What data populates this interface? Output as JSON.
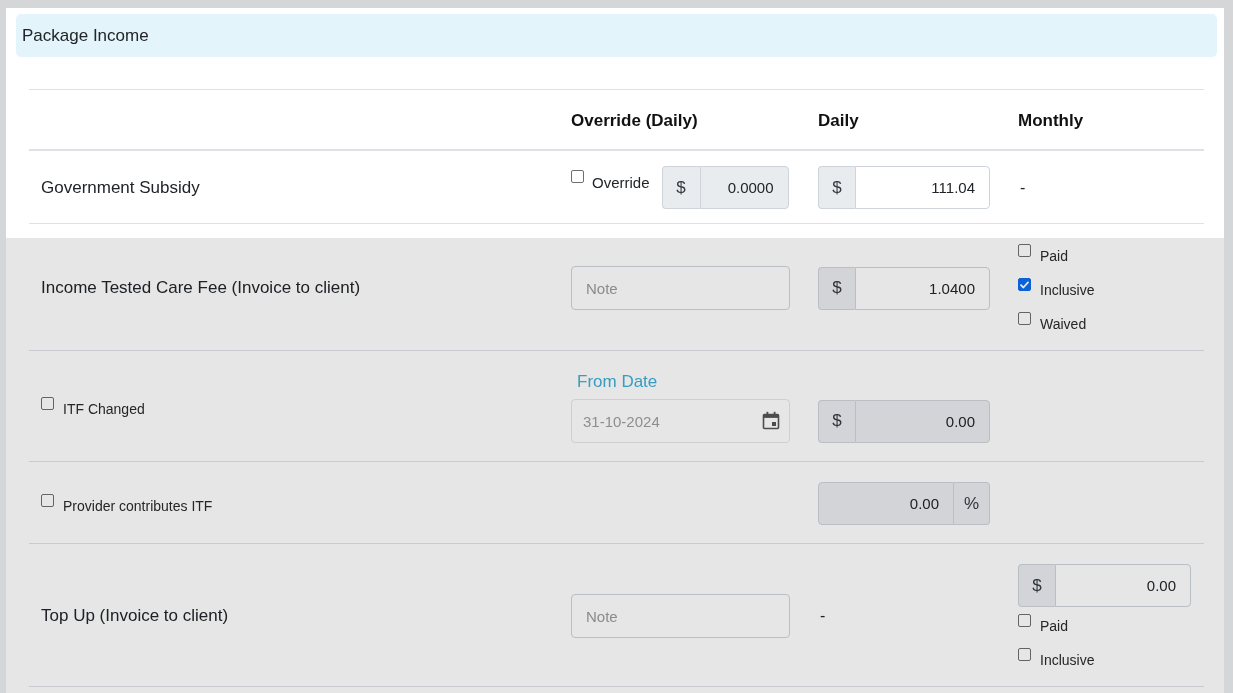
{
  "panel": {
    "title": "Package Income"
  },
  "table": {
    "columns": [
      "Override (Daily)",
      "Daily",
      "Monthly"
    ]
  },
  "groups": [
    {
      "dimmed": false,
      "rows": [
        {
          "label": {
            "kind": "plain",
            "text": "Government Subsidy"
          },
          "override": {
            "kind": "override",
            "checked": false,
            "label": "Override",
            "prefix": "$",
            "value": "0.0000",
            "disabled": true
          },
          "daily": {
            "kind": "money",
            "prefix": "$",
            "value": "111.04",
            "disabled": false
          },
          "monthly": {
            "kind": "text",
            "text": "-"
          }
        }
      ]
    },
    {
      "dimmed": true,
      "rows": [
        {
          "label": {
            "kind": "plain",
            "text": "Income Tested Care Fee (Invoice to client)"
          },
          "override": {
            "kind": "note",
            "placeholder": "Note"
          },
          "daily": {
            "kind": "money",
            "prefix": "$",
            "value": "1.0400",
            "disabled": false
          },
          "monthly": {
            "kind": "options",
            "options": [
              {
                "label": "Paid",
                "checked": false
              },
              {
                "label": "Inclusive",
                "checked": true
              },
              {
                "label": "Waived",
                "checked": false
              }
            ]
          }
        },
        {
          "label": {
            "kind": "checkbox",
            "text": "ITF Changed",
            "checked": false
          },
          "override": {
            "kind": "date",
            "label": "From Date",
            "value": "31-10-2024"
          },
          "daily": {
            "kind": "money",
            "prefix": "$",
            "value": "0.00",
            "disabled": true
          }
        },
        {
          "label": {
            "kind": "checkbox",
            "text": "Provider contributes ITF",
            "checked": false
          },
          "daily": {
            "kind": "percent",
            "value": "0.00",
            "suffix": "%",
            "disabled": true
          }
        },
        {
          "label": {
            "kind": "plain",
            "text": "Top Up (Invoice to client)"
          },
          "override": {
            "kind": "note",
            "placeholder": "Note"
          },
          "daily": {
            "kind": "text",
            "text": "-"
          },
          "monthly": {
            "kind": "money_options",
            "prefix": "$",
            "value": "0.00",
            "disabled": false,
            "options": [
              {
                "label": "Paid",
                "checked": false
              },
              {
                "label": "Inclusive",
                "checked": false
              }
            ]
          }
        }
      ]
    }
  ]
}
